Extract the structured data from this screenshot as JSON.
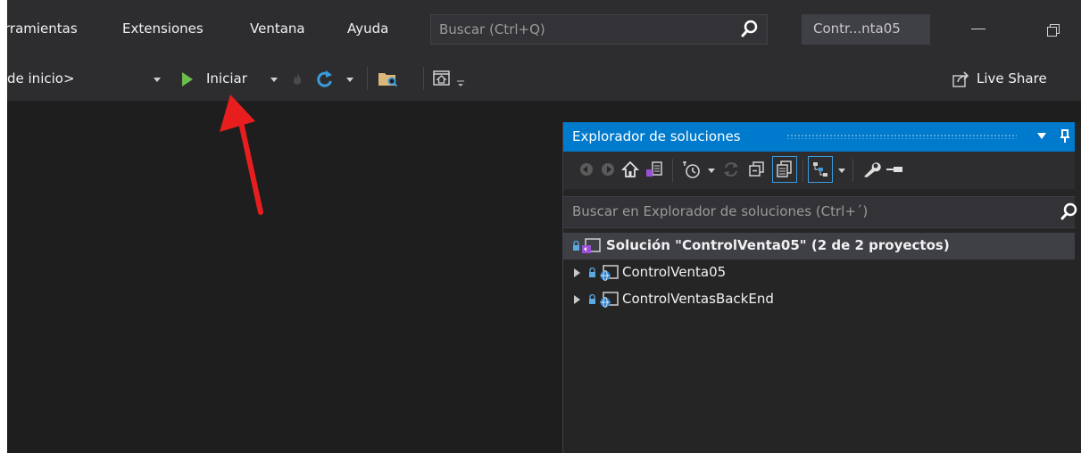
{
  "menu": {
    "items": [
      "rramientas",
      "Extensiones",
      "Ventana",
      "Ayuda"
    ],
    "search_placeholder": "Buscar (Ctrl+Q)",
    "window_title": "Contr...nta05"
  },
  "toolbar": {
    "startup_item": "de inicio>",
    "start_label": "Iniciar",
    "live_share_label": "Live Share"
  },
  "solution_explorer": {
    "title": "Explorador de soluciones",
    "search_placeholder": "Buscar en Explorador de soluciones (Ctrl+´)",
    "solution_label": "Solución \"ControlVenta05\" (2 de 2 proyectos)",
    "projects": [
      "ControlVenta05",
      "ControlVentasBackEnd"
    ]
  },
  "colors": {
    "accent": "#007acc",
    "start_green": "#6bbd4e",
    "annotation_arrow": "#e81e1e"
  }
}
